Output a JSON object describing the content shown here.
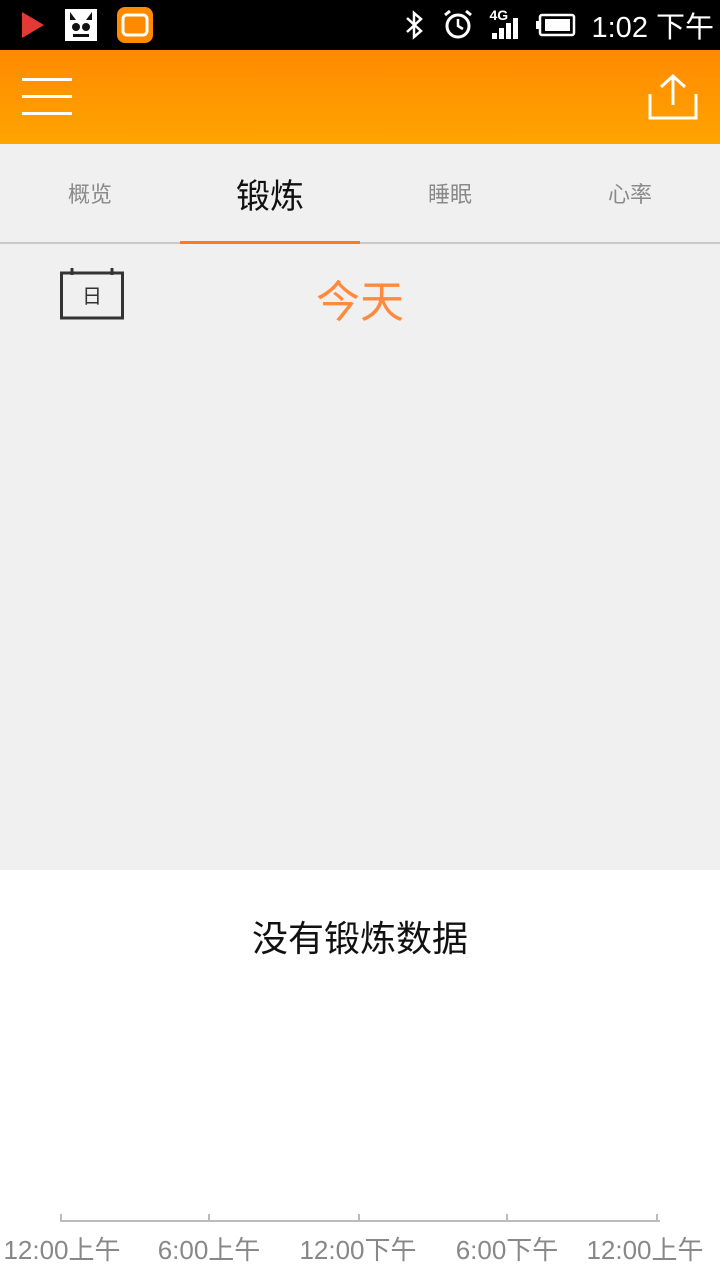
{
  "status_bar": {
    "time": "1:02 下午",
    "network_label": "4G",
    "icons": [
      "play-store-icon",
      "cat-app-icon",
      "orange-app-icon",
      "bluetooth-icon",
      "alarm-icon",
      "signal-icon",
      "battery-icon"
    ]
  },
  "app_bar": {
    "menu_icon": "menu-icon",
    "share_icon": "share-upload-icon"
  },
  "tabs": [
    {
      "label": "概览",
      "active": false
    },
    {
      "label": "锻炼",
      "active": true
    },
    {
      "label": "睡眠",
      "active": false
    },
    {
      "label": "心率",
      "active": false
    }
  ],
  "date_header": {
    "calendar_icon": "calendar-icon",
    "calendar_glyph": "日",
    "label": "今天"
  },
  "content": {
    "empty_message": "没有锻炼数据"
  },
  "timeline": {
    "ticks": [
      "12:00上午",
      "6:00上午",
      "12:00下午",
      "6:00下午",
      "12:00上午"
    ]
  },
  "colors": {
    "app_bar_top": "#ff8a00",
    "app_bar_bottom": "#ffa400",
    "accent": "#ff7a1a",
    "date_label": "#ff8a3d"
  }
}
